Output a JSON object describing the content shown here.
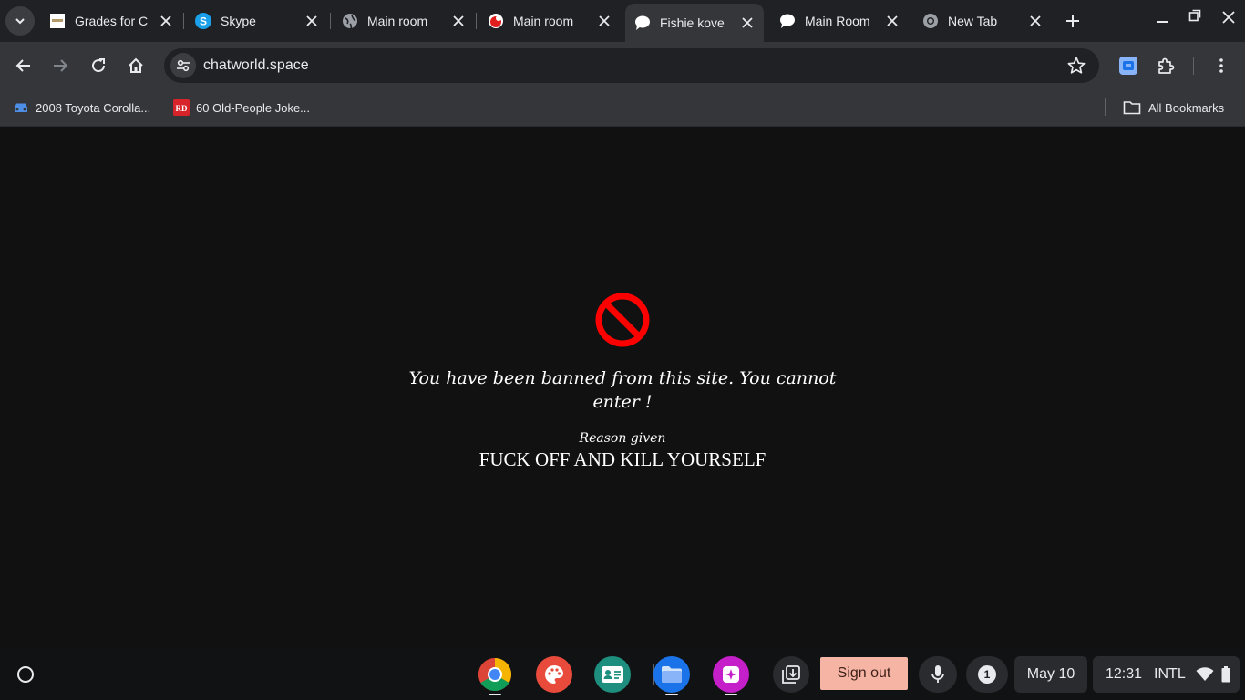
{
  "tabstrip": {
    "tabs": [
      {
        "title": "Grades for C",
        "favicon": "grades-favicon"
      },
      {
        "title": "Skype",
        "favicon": "skype-icon"
      },
      {
        "title": "Main room",
        "favicon": "globe-icon"
      },
      {
        "title": "Main room",
        "favicon": "chat-red-icon"
      },
      {
        "title": "Fishie kove",
        "favicon": "chat-bubble-icon",
        "active": true
      },
      {
        "title": "Main Room",
        "favicon": "chat-bubble-icon"
      },
      {
        "title": "New Tab",
        "favicon": "chrome-icon"
      }
    ]
  },
  "toolbar": {
    "url": "chatworld.space"
  },
  "bookmarks": {
    "items": [
      {
        "label": "2008 Toyota Corolla...",
        "icon": "car-icon"
      },
      {
        "label": "60 Old-People Joke...",
        "icon": "rd-icon"
      }
    ],
    "all_bookmarks": "All Bookmarks"
  },
  "page": {
    "ban_message": "You have been banned from this site. You cannot enter !",
    "reason_label": "Reason given",
    "reason_text": "FUCK OFF AND KILL YOURSELF"
  },
  "shelf": {
    "sign_out": "Sign out",
    "notification_count": "1",
    "date": "May 10",
    "time": "12:31",
    "input_method": "INTL"
  },
  "colors": {
    "page_bg": "#111111",
    "ban_red": "#ff0000",
    "sign_out_bg": "#f6b5a4"
  }
}
